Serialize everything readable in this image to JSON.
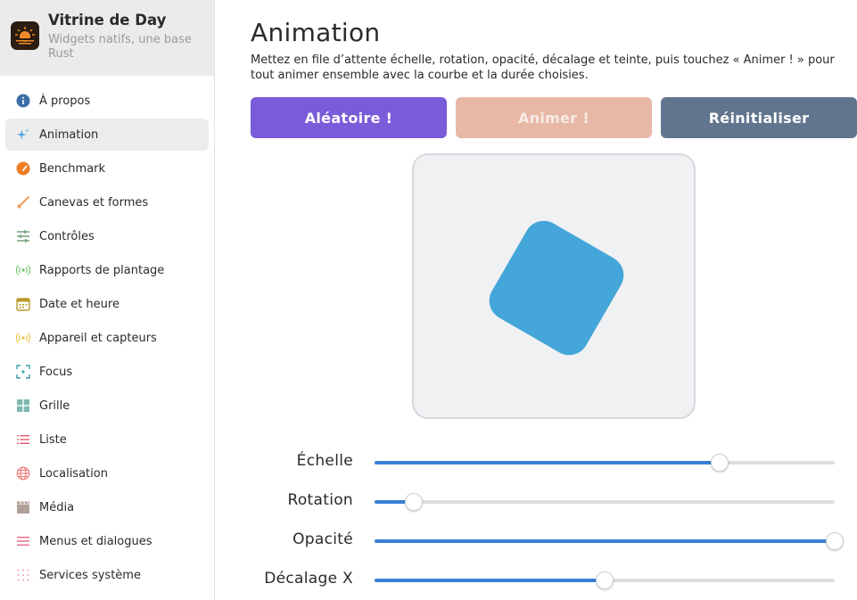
{
  "app": {
    "title": "Vitrine de Day",
    "subtitle": "Widgets natifs, une base Rust"
  },
  "sidebar": {
    "items": [
      {
        "label": "À propos",
        "icon": "info-icon",
        "color": "#3d6fa8",
        "active": false
      },
      {
        "label": "Animation",
        "icon": "sparkle-icon",
        "color": "#4ea3e0",
        "active": true
      },
      {
        "label": "Benchmark",
        "icon": "speedometer-icon",
        "color": "#ee7d23",
        "active": false
      },
      {
        "label": "Canevas et formes",
        "icon": "brush-icon",
        "color": "#f0a060",
        "active": false
      },
      {
        "label": "Contrôles",
        "icon": "sliders-icon",
        "color": "#6a9a70",
        "active": false
      },
      {
        "label": "Rapports de plantage",
        "icon": "broadcast-icon",
        "color": "#6cc86c",
        "active": false
      },
      {
        "label": "Date et heure",
        "icon": "calendar-icon",
        "color": "#b99a28",
        "active": false
      },
      {
        "label": "Appareil et capteurs",
        "icon": "sensor-icon",
        "color": "#e8c040",
        "active": false
      },
      {
        "label": "Focus",
        "icon": "focus-icon",
        "color": "#3aa0a8",
        "active": false
      },
      {
        "label": "Grille",
        "icon": "grid-icon",
        "color": "#7fb8b0",
        "active": false
      },
      {
        "label": "Liste",
        "icon": "list-icon",
        "color": "#e05a6a",
        "active": false
      },
      {
        "label": "Localisation",
        "icon": "globe-icon",
        "color": "#ee8080",
        "active": false
      },
      {
        "label": "Média",
        "icon": "clapper-icon",
        "color": "#b0a098",
        "active": false
      },
      {
        "label": "Menus et dialogues",
        "icon": "menu-icon",
        "color": "#e86a86",
        "active": false
      },
      {
        "label": "Services système",
        "icon": "dots-grid-icon",
        "color": "#e8a0b0",
        "active": false
      }
    ]
  },
  "main": {
    "title": "Animation",
    "description": "Mettez en file d’attente échelle, rotation, opacité, décalage et teinte, puis touchez « Animer ! » pour tout animer ensemble avec la courbe et la durée choisies.",
    "buttons": {
      "random": "Aléatoire !",
      "animate": "Animer !",
      "reset": "Réinitialiser"
    },
    "sliders": [
      {
        "label": "Échelle",
        "value_fraction": 0.75
      },
      {
        "label": "Rotation",
        "value_fraction": 0.085
      },
      {
        "label": "Opacité",
        "value_fraction": 1.0
      },
      {
        "label": "Décalage X",
        "value_fraction": 0.5
      }
    ]
  },
  "colors": {
    "accent_purple": "#7a5bd9",
    "animate_disabled": "#e8b8a7",
    "reset_slate": "#61758e",
    "shape_blue": "#44a6d9",
    "slider_blue": "#3a7fd6"
  }
}
